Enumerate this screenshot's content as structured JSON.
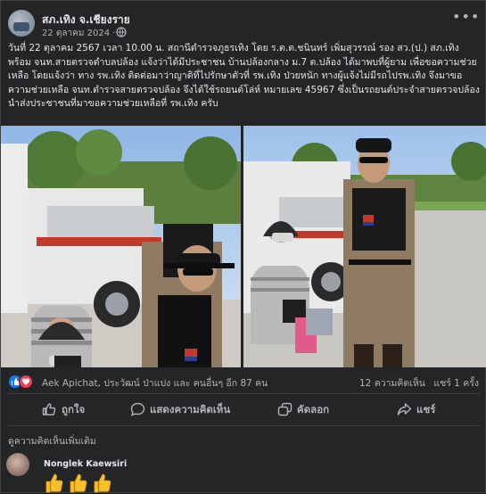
{
  "post": {
    "page_name": "สภ.เทิง จ.เชียงราย",
    "time": "22 ตุลาคม 2024 ·",
    "more_label": "•••",
    "text": "วันที่ 22 ตุลาคม 2567 เวลา 10.00 น. สถานีตำรวจภูธรเทิง โดย ร.ต.ต.ชนินทร์  เพิ่มสุวรรณ์ รอง สว.(ป.) สภ.เทิง พร้อม จนท.สายตรวจตำบลปล้อง แจ้งว่าได้มีประชาชน บ้านปล้องกลาง ม.7 ต.ปล้อง ได้มาพบที่ผู้ยาม เพื่อขอความช่วยเหลือ โดยแจ้งว่า ทาง รพ.เทิง ติดต่อมาว่าญาติที่ไปรักษาตัวที่ รพ.เทิง ป่วยหนัก ทางผู้แจ้งไม่มีรถไปรพ.เทิง จึงมาขอความช่วยเหลือ จนท.ตำรวจสายตรวจปล้อง จึงได้ใช้รถยนต์โล่ห์ หมายเลข 45967 ซึ่งเป็นรถยนต์ประจำสายตรวจปล้อง นำส่งประชาชนที่มาขอความช่วยเหลือที่ รพ.เทิง ครับ"
  },
  "reactions": {
    "names": "Aek Apichat, ประวัฒน์ ป่าแปง และ คนอื่นๆ อีก 87 คน",
    "comments": "12 ความคิดเห็น",
    "shares": "แชร์ 1 ครั้ง"
  },
  "actions": {
    "like": "ถูกใจ",
    "comment": "แสดงความคิดเห็น",
    "copy": "คัดลอก",
    "share": "แชร์"
  },
  "comments": {
    "view_more": "ดูความคิดเห็นเพิ่มเติม",
    "commenter": "Nonglek Kaewsiri"
  },
  "theme": {
    "background": "#242526",
    "text": "#e4e6eb",
    "secondary_text": "#b0b3b8",
    "like_blue": "#1877f2",
    "love_red": "#f33e58"
  },
  "icons": [
    "globe-icon",
    "more-options-icon",
    "like-reaction-icon",
    "love-reaction-icon",
    "thumb-up-icon",
    "comment-icon",
    "copy-icon",
    "share-icon",
    "thumbs-up-emoji"
  ]
}
